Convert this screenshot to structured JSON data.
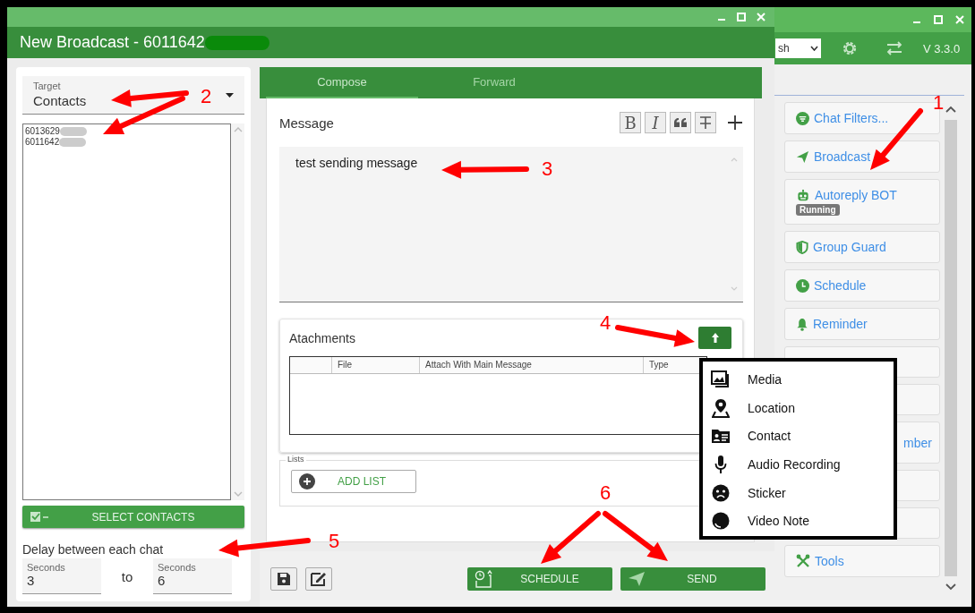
{
  "main_window": {
    "title": "New Broadcast - 6011642"
  },
  "target": {
    "label": "Target",
    "value": "Contacts"
  },
  "contacts": [
    "6013629",
    "6011642"
  ],
  "select_contacts_button": "SELECT CONTACTS",
  "delay": {
    "label": "Delay between each chat",
    "separator": "to",
    "from": {
      "label": "Seconds",
      "value": "3"
    },
    "to": {
      "label": "Seconds",
      "value": "6"
    }
  },
  "tabs": [
    {
      "label": "Compose",
      "selected": true
    },
    {
      "label": "Forward",
      "selected": false
    }
  ],
  "message": {
    "label": "Message",
    "format_buttons": [
      "B",
      "I"
    ],
    "value": "test sending message"
  },
  "attachments": {
    "label": "Atachments",
    "columns": [
      "File",
      "Attach With Main Message",
      "Type"
    ]
  },
  "lists": {
    "label": "Lists",
    "add_button": "ADD LIST"
  },
  "actions": [
    "SCHEDULE",
    "SEND"
  ],
  "attach_menu": [
    "Media",
    "Location",
    "Contact",
    "Audio Recording",
    "Sticker",
    "Video Note"
  ],
  "side_window": {
    "language": "sh",
    "version": "V 3.3.0",
    "items": [
      {
        "kind": "entry",
        "label": "Chat Filters..."
      },
      {
        "kind": "entry",
        "label": "Broadcast"
      },
      {
        "kind": "entry",
        "label": "Autoreply BOT",
        "badge": "Running"
      },
      {
        "kind": "entry",
        "label": "Group Guard"
      },
      {
        "kind": "entry",
        "label": "Schedule"
      },
      {
        "kind": "entry",
        "label": "Reminder"
      },
      {
        "kind": "covered"
      },
      {
        "kind": "covered"
      },
      {
        "kind": "cut",
        "label": "mber"
      },
      {
        "kind": "covered"
      },
      {
        "kind": "covered"
      },
      {
        "kind": "entry",
        "label": "Tools"
      }
    ]
  },
  "annotations": [
    "1",
    "2",
    "3",
    "4",
    "5",
    "6"
  ]
}
